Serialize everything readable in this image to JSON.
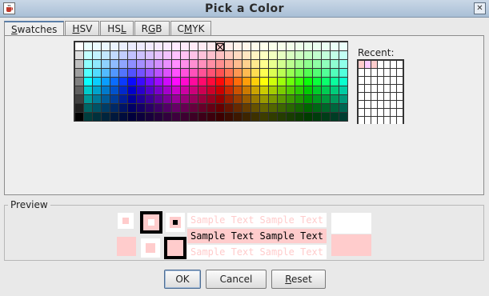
{
  "window": {
    "title": "Pick a Color",
    "app_icon": "java-cup-icon",
    "close_label": "✕"
  },
  "tabs": [
    {
      "label": "Swatches",
      "mnemonic_index": 0,
      "active": true
    },
    {
      "label": "HSV",
      "mnemonic_index": 0,
      "active": false
    },
    {
      "label": "HSL",
      "mnemonic_index": 2,
      "active": false
    },
    {
      "label": "RGB",
      "mnemonic_index": 1,
      "active": false
    },
    {
      "label": "CMYK",
      "mnemonic_index": 1,
      "active": false
    }
  ],
  "swatches": {
    "columns": 31,
    "rows": 9,
    "selected_color": "#ffcccc",
    "selected_index": 16
  },
  "recent": {
    "label": "Recent:",
    "columns": 7,
    "rows": 8,
    "colors": [
      "#ffcccc",
      "#ffccff",
      "#ffcccc"
    ]
  },
  "preview": {
    "label": "Preview",
    "sample_text": "Sample Text",
    "color": "#ffcccc"
  },
  "buttons": {
    "ok": {
      "label": "OK"
    },
    "cancel": {
      "label": "Cancel"
    },
    "reset": {
      "label": "Reset",
      "mnemonic_index": 0
    }
  }
}
